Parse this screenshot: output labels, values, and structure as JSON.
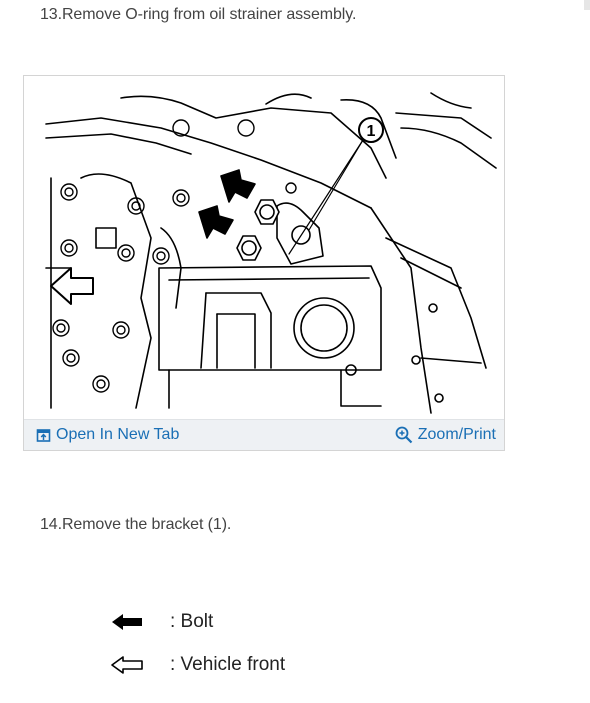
{
  "steps": [
    {
      "text": "13.Remove O-ring from oil strainer assembly."
    },
    {
      "text": "14.Remove the bracket (1)."
    }
  ],
  "figure": {
    "callout_number": "1",
    "links": {
      "open_new_tab": "Open In New Tab",
      "zoom_print": "Zoom/Print"
    },
    "link_color": "#1a6fb5",
    "bar_color": "#eef1f4"
  },
  "legend": [
    {
      "icon": "solid-arrow-left-icon",
      "label": ": Bolt"
    },
    {
      "icon": "outline-arrow-left-icon",
      "label": ": Vehicle front"
    }
  ]
}
